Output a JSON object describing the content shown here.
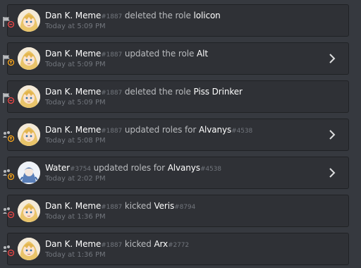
{
  "entries": [
    {
      "user": "Dan K. Meme",
      "user_disc": "#1887",
      "action": "deleted the role",
      "target": "lolicon",
      "target_disc": "",
      "time": "Today at 5:09 PM",
      "type": "role",
      "avatar": "anime",
      "expandable": false
    },
    {
      "user": "Dan K. Meme",
      "user_disc": "#1887",
      "action": "updated the role",
      "target": "Alt",
      "target_disc": "",
      "time": "Today at 5:09 PM",
      "type": "role-update",
      "avatar": "anime",
      "expandable": true
    },
    {
      "user": "Dan K. Meme",
      "user_disc": "#1887",
      "action": "deleted the role",
      "target": "Piss Drinker",
      "target_disc": "",
      "time": "Today at 5:09 PM",
      "type": "role",
      "avatar": "anime",
      "expandable": false
    },
    {
      "user": "Dan K. Meme",
      "user_disc": "#1887",
      "action": "updated roles for",
      "target": "Alvanys",
      "target_disc": "#4538",
      "time": "Today at 5:08 PM",
      "type": "member",
      "avatar": "anime",
      "expandable": true
    },
    {
      "user": "Water",
      "user_disc": "#3754",
      "action": "updated roles for",
      "target": "Alvanys",
      "target_disc": "#4538",
      "time": "Today at 2:02 PM",
      "type": "member",
      "avatar": "water",
      "expandable": true
    },
    {
      "user": "Dan K. Meme",
      "user_disc": "#1887",
      "action": "kicked",
      "target": "Veris",
      "target_disc": "#8794",
      "time": "Today at 1:36 PM",
      "type": "kick",
      "avatar": "anime",
      "expandable": false
    },
    {
      "user": "Dan K. Meme",
      "user_disc": "#1887",
      "action": "kicked",
      "target": "Arx",
      "target_disc": "#2772",
      "time": "Today at 1:36 PM",
      "type": "kick",
      "avatar": "anime",
      "expandable": false
    }
  ],
  "icons": {
    "role": "flag-delete-icon",
    "role-update": "flag-update-icon",
    "member": "members-update-icon",
    "kick": "members-kick-icon",
    "chevron": "chevron-right-icon"
  },
  "colors": {
    "background": "#36393f",
    "card": "#2f3136",
    "delete": "#f04747",
    "update": "#faa61a",
    "icon_grey": "#b9bbbe"
  }
}
